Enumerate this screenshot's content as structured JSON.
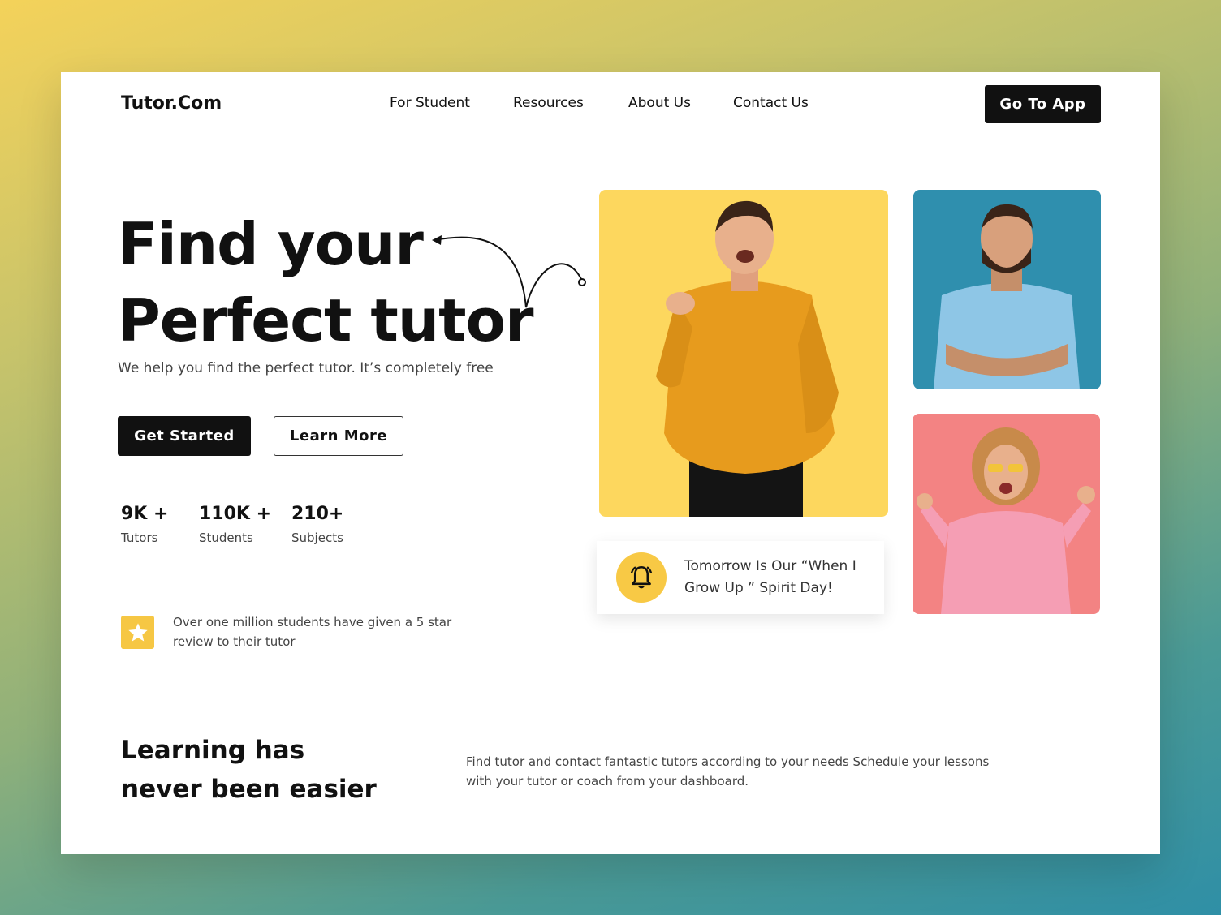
{
  "header": {
    "logo": "Tutor.Com",
    "nav": [
      "For Student",
      "Resources",
      "About Us",
      "Contact Us"
    ],
    "cta": "Go To App"
  },
  "hero": {
    "title_line1": "Find your",
    "title_line2": "Perfect tutor",
    "subtitle": "We help you find the perfect tutor. It’s completely free",
    "primary_button": "Get Started",
    "secondary_button": "Learn More"
  },
  "stats": [
    {
      "value": "9K +",
      "label": "Tutors"
    },
    {
      "value": "110K +",
      "label": "Students"
    },
    {
      "value": "210+",
      "label": "Subjects"
    }
  ],
  "review": {
    "text": "Over one million students have given a 5 star review to their tutor",
    "icon": "star-icon"
  },
  "notice": {
    "icon": "bell-icon",
    "text": "Tomorrow Is Our “When I Grow Up ” Spirit Day!"
  },
  "bottom": {
    "title_line1": "Learning has",
    "title_line2": "never been easier",
    "description": "Find tutor and contact fantastic tutors according to your needs Schedule your lessons with your tutor or coach from your dashboard."
  },
  "colors": {
    "yellow_card": "#fdd75e",
    "blue_card": "#2f8fae",
    "pink_card": "#f38383",
    "accent_yellow": "#f6c744",
    "dark": "#111111"
  }
}
